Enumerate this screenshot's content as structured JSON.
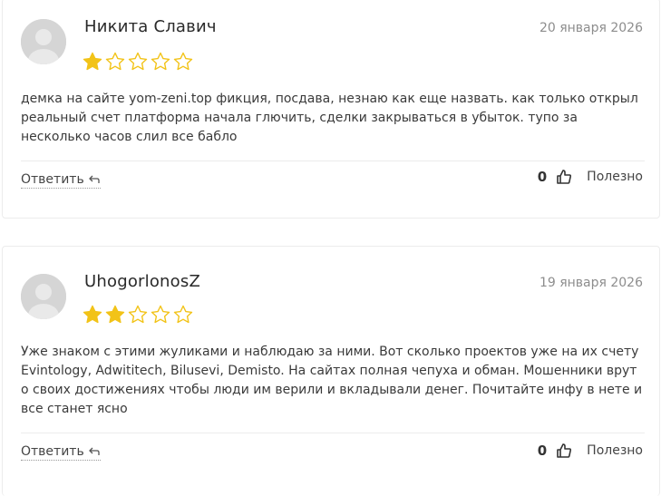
{
  "reviews": [
    {
      "author": "Никита Славич",
      "date": "20 января 2026",
      "rating": 1,
      "max_rating": 5,
      "text": "демка на сайте yom-zeni.top фикция, посдава, незнаю как еще назвать. как только открыл реальный счет платформа начала глючить, сделки закрываться в убыток. тупо за несколько часов слил все бабло",
      "reply_label": "Ответить",
      "useful_count": "0",
      "useful_label": "Полезно"
    },
    {
      "author": "UhogorlonosZ",
      "date": "19 января 2026",
      "rating": 2,
      "max_rating": 5,
      "text": "Уже знаком с этими жуликами и наблюдаю за ними. Вот сколько проектов уже на их счету Evintology, Adwititech, Bilusevi, Demisto. На сайтах полная чепуха и обман. Мошенники врут о своих достижениях чтобы люди им верили и вкладывали денег. Почитайте инфу в нете и все станет ясно",
      "reply_label": "Ответить",
      "useful_count": "0",
      "useful_label": "Полезно"
    }
  ],
  "colors": {
    "star_filled": "#f2c318",
    "star_empty_stroke": "#f2c318",
    "avatar_bg": "#d5d5d5",
    "border": "#ececec"
  },
  "icons": {
    "avatar": "user-avatar-icon",
    "star": "star-icon",
    "reply": "reply-arrow-icon",
    "like": "thumbs-up-icon"
  }
}
